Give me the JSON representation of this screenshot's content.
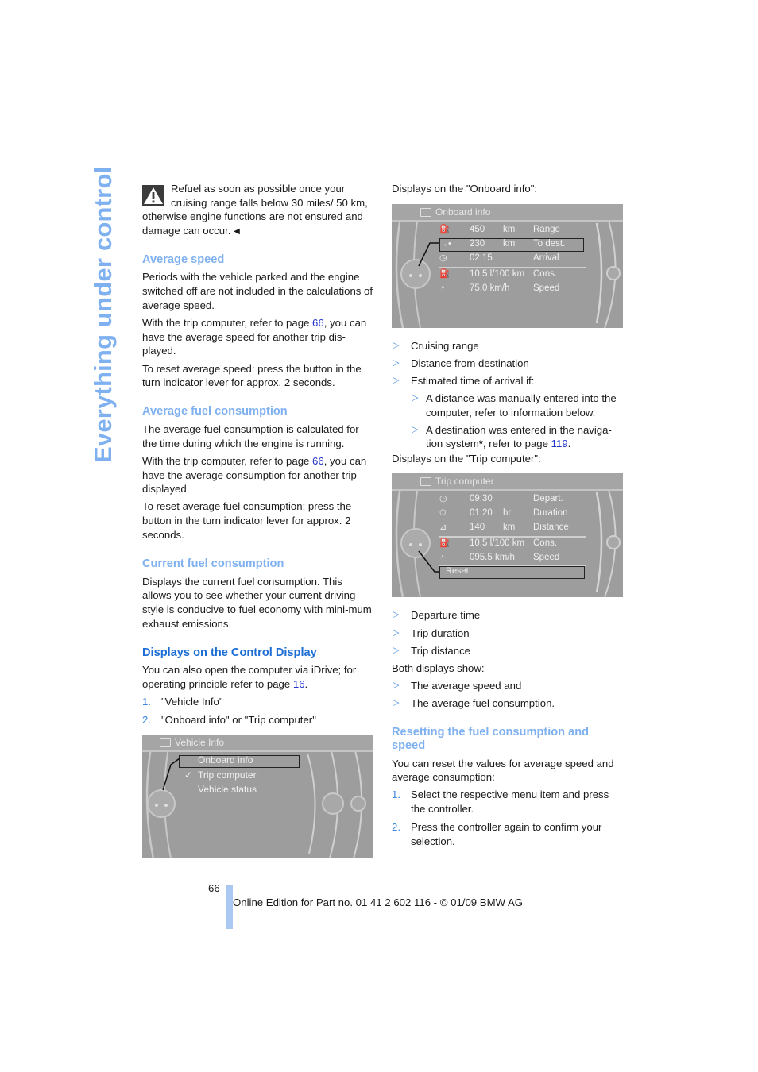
{
  "side_title": "Everything under control",
  "warning": {
    "icon": "warning-triangle-icon",
    "text": "Refuel as soon as possible once your cruising range falls below 30 miles/ 50 km, otherwise engine functions are not ensured and damage can occur.",
    "end_mark": "◀"
  },
  "average_speed": {
    "heading": "Average speed",
    "p1": "Periods with the vehicle parked and the engine switched off are not included in the calculations of average speed.",
    "p2_before": "With the trip computer, refer to page ",
    "p2_link": "66",
    "p2_after": ", you can have the average speed for another trip dis-played.",
    "p3": "To reset average speed: press the button in the turn indicator lever for approx. 2 seconds."
  },
  "average_fuel": {
    "heading": "Average fuel consumption",
    "p1": "The average fuel consumption is calculated for the time during which the engine is running.",
    "p2_before": "With the trip computer, refer to page ",
    "p2_link": "66",
    "p2_after": ", you can have the average consumption for another trip displayed.",
    "p3": "To reset average fuel consumption: press the button in the turn indicator lever for approx. 2 seconds."
  },
  "current_fuel": {
    "heading": "Current fuel consumption",
    "p1": "Displays the current fuel consumption. This allows you to see whether your current driving style is conducive to fuel economy with mini-mum exhaust emissions."
  },
  "control_display": {
    "heading": "Displays on the Control Display",
    "p1_before": "You can also open the computer via iDrive; for operating principle refer to page ",
    "p1_link": "16",
    "p1_after": ".",
    "steps": [
      {
        "num": "1.",
        "text": "\"Vehicle Info\""
      },
      {
        "num": "2.",
        "text": "\"Onboard info\" or \"Trip computer\""
      }
    ]
  },
  "screen_vehicle_info": {
    "title": "Vehicle Info",
    "items": [
      {
        "label": "Onboard info",
        "selected": true,
        "checked": false
      },
      {
        "label": "Trip computer",
        "selected": false,
        "checked": true
      },
      {
        "label": "Vehicle status",
        "selected": false,
        "checked": false
      }
    ],
    "check_mark": "✓"
  },
  "onboard_intro": "Displays on the \"Onboard info\":",
  "screen_onboard": {
    "title": "Onboard info",
    "rows": [
      {
        "icon": "fuel-range-icon",
        "value": "450",
        "unit": "km",
        "label": "Range",
        "selected": false
      },
      {
        "icon": "destination-arrow-icon",
        "value": "230",
        "unit": "km",
        "label": "To dest.",
        "selected": true
      },
      {
        "icon": "arrival-clock-icon",
        "value": "02:15",
        "unit": "",
        "label": "Arrival",
        "selected": false
      },
      {
        "icon": "fuel-pump-icon",
        "value": "10.5 l/100 km",
        "unit": "",
        "label": "Cons.",
        "selected": false
      },
      {
        "icon": "speedometer-icon",
        "value": "75.0 km/h",
        "unit": "",
        "label": "Speed",
        "selected": false
      }
    ]
  },
  "onboard_list": [
    "Cruising range",
    "Distance from destination",
    "Estimated time of arrival if:"
  ],
  "onboard_sublist": {
    "item1": "A distance was manually entered into the computer, refer to information below.",
    "item2_before": "A destination was entered in the naviga-tion system",
    "item2_star": "*",
    "item2_mid": ", refer to page ",
    "item2_link": "119",
    "item2_after": "."
  },
  "trip_intro": "Displays on the \"Trip computer\":",
  "screen_trip": {
    "title": "Trip computer",
    "rows": [
      {
        "icon": "departure-clock-icon",
        "value": "09:30",
        "unit": "",
        "label": "Depart."
      },
      {
        "icon": "stopwatch-icon",
        "value": "01:20",
        "unit": "hr",
        "label": "Duration"
      },
      {
        "icon": "road-distance-icon",
        "value": "140",
        "unit": "km",
        "label": "Distance"
      },
      {
        "icon": "fuel-pump-icon",
        "value": "10.5 l/100 km",
        "unit": "",
        "label": "Cons."
      },
      {
        "icon": "speedometer-icon",
        "value": "095.5 km/h",
        "unit": "",
        "label": "Speed"
      }
    ],
    "reset_label": "Reset"
  },
  "trip_list": [
    "Departure time",
    "Trip duration",
    "Trip distance"
  ],
  "both_intro": "Both displays show:",
  "both_list": [
    "The average speed and",
    "The average fuel consumption."
  ],
  "resetting": {
    "heading": "Resetting the fuel consumption and speed",
    "p1": "You can reset the values for average speed and average consumption:",
    "steps": [
      {
        "num": "1.",
        "text": "Select the respective menu item and press the controller."
      },
      {
        "num": "2.",
        "text": "Press the controller again to confirm your selection."
      }
    ]
  },
  "bullet_glyph": "▷",
  "footer": {
    "page_number": "66",
    "text": "Online Edition for Part no. 01 41 2 602 116 - © 01/09 BMW AG"
  },
  "colors": {
    "heading_light": "#7fb1f0",
    "heading_dark": "#1c6ed4",
    "link": "#2233cc",
    "accent": "#3a86e0",
    "screen_bg": "#9d9d9d",
    "footer_bar": "#a9c9f3"
  }
}
